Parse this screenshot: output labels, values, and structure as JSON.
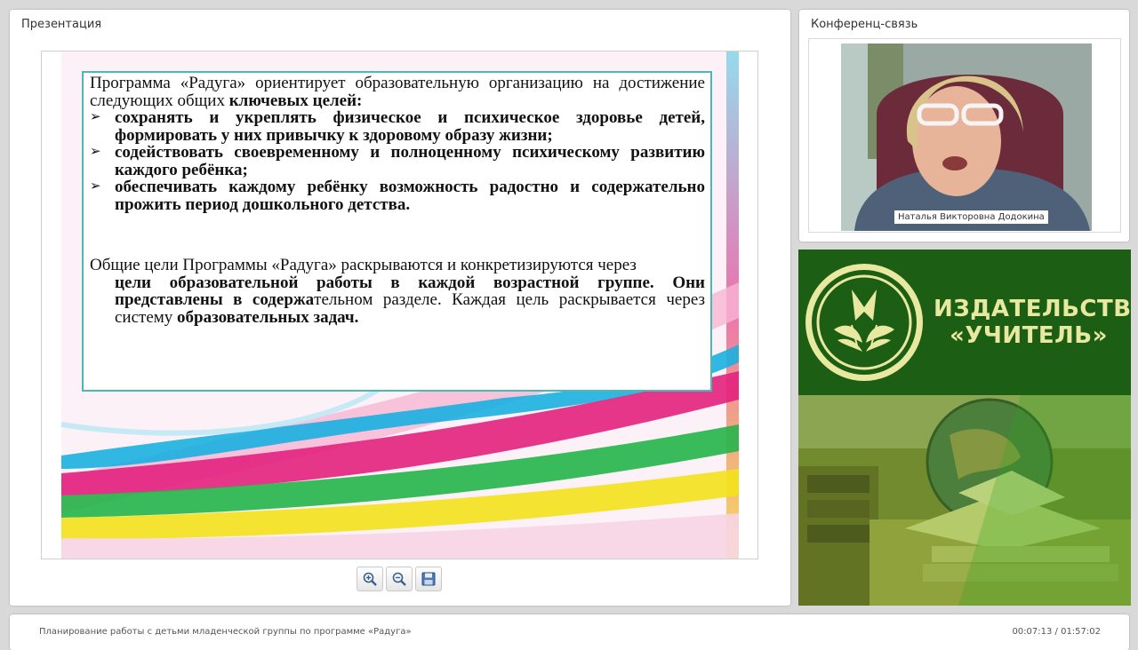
{
  "presentation_panel": {
    "title": "Презентация"
  },
  "conference_panel": {
    "title": "Конференц-связь",
    "speaker_name": "Наталья Викторовна Додокина"
  },
  "slide": {
    "intro_plain": "Программа «Радуга» ориентирует образовательную организацию на достижение следующих общих ",
    "intro_bold": "ключевых целей:",
    "bullets": [
      "сохранять и укреплять физическое и психическое здоровье детей, формировать у них привычку к здоровому образу жизни;",
      "содействовать своевременному и полноценному психическому развитию каждого ребёнка;",
      "обеспечивать каждому ребёнку возможность радостно и содержательно прожить период дошкольного детства."
    ],
    "outro_1": "Общие цели Программы «Радуга» раскрываются и конкретизируются через",
    "outro_2": "цели образовательной работы в каждой возрастной группе. Они представлены в содержа",
    "outro_3": "тельном разделе. Каждая цель раскрывается через систему ",
    "outro_4": "образовательных задач."
  },
  "toolbar": {
    "zoom_in_icon": "zoom-in-icon",
    "zoom_out_icon": "zoom-out-icon",
    "save_icon": "save-icon"
  },
  "publisher": {
    "line1": "ИЗДАТЕЛЬСТВО",
    "line2": "«УЧИТЕЛЬ»",
    "brand_color": "#1c5f14",
    "text_color": "#e9e8a0"
  },
  "footer": {
    "lecture_title": "Планирование работы с детьми младенческой группы по программе «Радуга»",
    "timer": "00:07:13 / 01:57:02"
  }
}
